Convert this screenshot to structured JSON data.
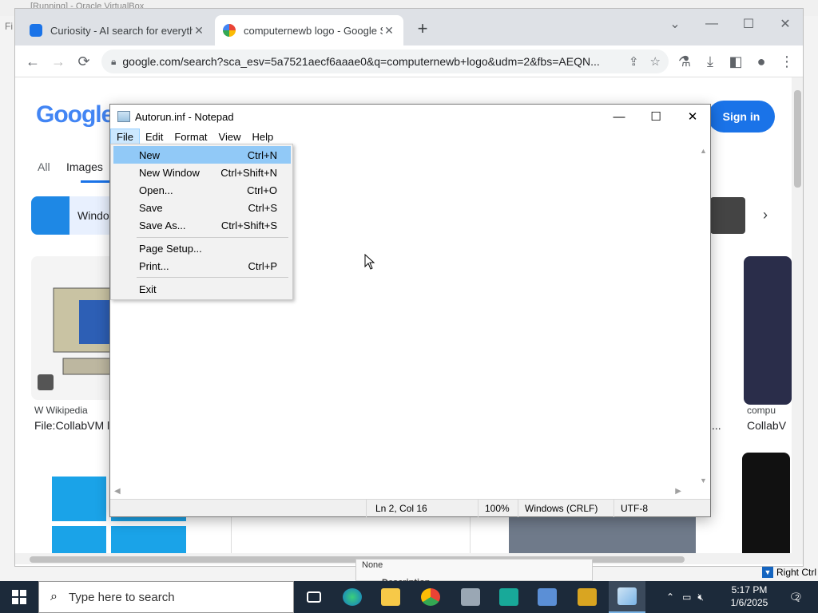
{
  "vm": {
    "title_fragment": "[Running] - Oracle VirtualBox",
    "left_letter": "Fi"
  },
  "browser": {
    "tabs": [
      {
        "label": "Curiosity - AI search for everythi",
        "icon": "curiosity-favicon"
      },
      {
        "label": "computernewb logo - Google Se",
        "icon": "google-favicon"
      }
    ],
    "new_tab_glyph": "+",
    "url": "google.com/search?sca_esv=5a7521aecf6aaae0&q=computernewb+logo&udm=2&fbs=AEQN...",
    "nav": {
      "back": "←",
      "forward": "→",
      "reload": "⟳"
    }
  },
  "google": {
    "logo": "Google",
    "sign_in": "Sign in",
    "tabs": {
      "all": "All",
      "images": "Images"
    },
    "chip_label": "Windo",
    "results": {
      "left_source": "W Wikipedia",
      "left_title": "File:CollabVM l",
      "right_source": "compu",
      "right_title": "CollabV",
      "ellipsis": "..."
    }
  },
  "notepad": {
    "title": "Autorun.inf - Notepad",
    "menu": [
      "File",
      "Edit",
      "Format",
      "View",
      "Help"
    ],
    "file_menu": [
      {
        "label": "New",
        "shortcut": "Ctrl+N"
      },
      {
        "label": "New Window",
        "shortcut": "Ctrl+Shift+N"
      },
      {
        "label": "Open...",
        "shortcut": "Ctrl+O"
      },
      {
        "label": "Save",
        "shortcut": "Ctrl+S"
      },
      {
        "label": "Save As...",
        "shortcut": "Ctrl+Shift+S"
      },
      {
        "label": "Page Setup...",
        "shortcut": ""
      },
      {
        "label": "Print...",
        "shortcut": "Ctrl+P"
      },
      {
        "label": "Exit",
        "shortcut": ""
      }
    ],
    "status": {
      "position": "Ln 2, Col 16",
      "zoom": "100%",
      "eol": "Windows (CRLF)",
      "encoding": "UTF-8"
    }
  },
  "behind": {
    "none": "None",
    "description": "Description"
  },
  "host": {
    "right_ctrl": "Right Ctrl"
  },
  "taskbar": {
    "search_placeholder": "Type here to search",
    "time": "5:17 PM",
    "date": "1/6/2025",
    "notifications": "2"
  },
  "colors": {
    "accent": "#1a73e8",
    "menu_highlight": "#91c9f7",
    "taskbar": "#1c2a3a"
  }
}
